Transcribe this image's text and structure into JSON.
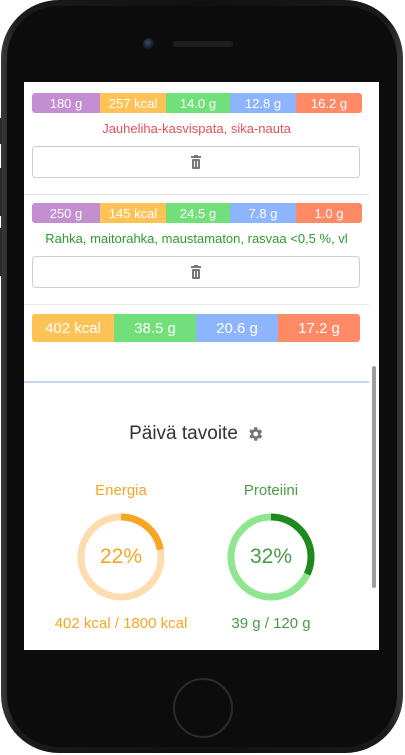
{
  "entries": [
    {
      "weight": "180 g",
      "kcal": "257 kcal",
      "carbs": "14.0 g",
      "protein": "12.8 g",
      "fat": "16.2 g",
      "name": "Jauheliha-kasvispata, sika-nauta",
      "name_color": "#e0525a"
    },
    {
      "weight": "250 g",
      "kcal": "145 kcal",
      "carbs": "24.5 g",
      "protein": "7.8 g",
      "fat": "1.0 g",
      "name": "Rahka, maitorahka, maustamaton, rasvaa <0,5 %, vl",
      "name_color": "#2e9b2e"
    }
  ],
  "totals": {
    "kcal": "402 kcal",
    "carbs": "38.5 g",
    "protein": "20.6 g",
    "fat": "17.2 g"
  },
  "goal": {
    "title": "Päivä tavoite",
    "energy": {
      "label": "Energia",
      "percent_text": "22%",
      "fraction": 0.22,
      "detail": "402 kcal / 1800 kcal",
      "color": "#f5a623",
      "track_color": "#fddcb0"
    },
    "protein": {
      "label": "Proteiini",
      "percent_text": "32%",
      "fraction": 0.32,
      "detail": "39 g / 120 g",
      "color": "#1e8a1e",
      "track_color": "#8fe68f",
      "text_color": "#4a9a4a"
    }
  },
  "icons": {
    "delete": "trash-icon",
    "settings": "gear-icon"
  }
}
